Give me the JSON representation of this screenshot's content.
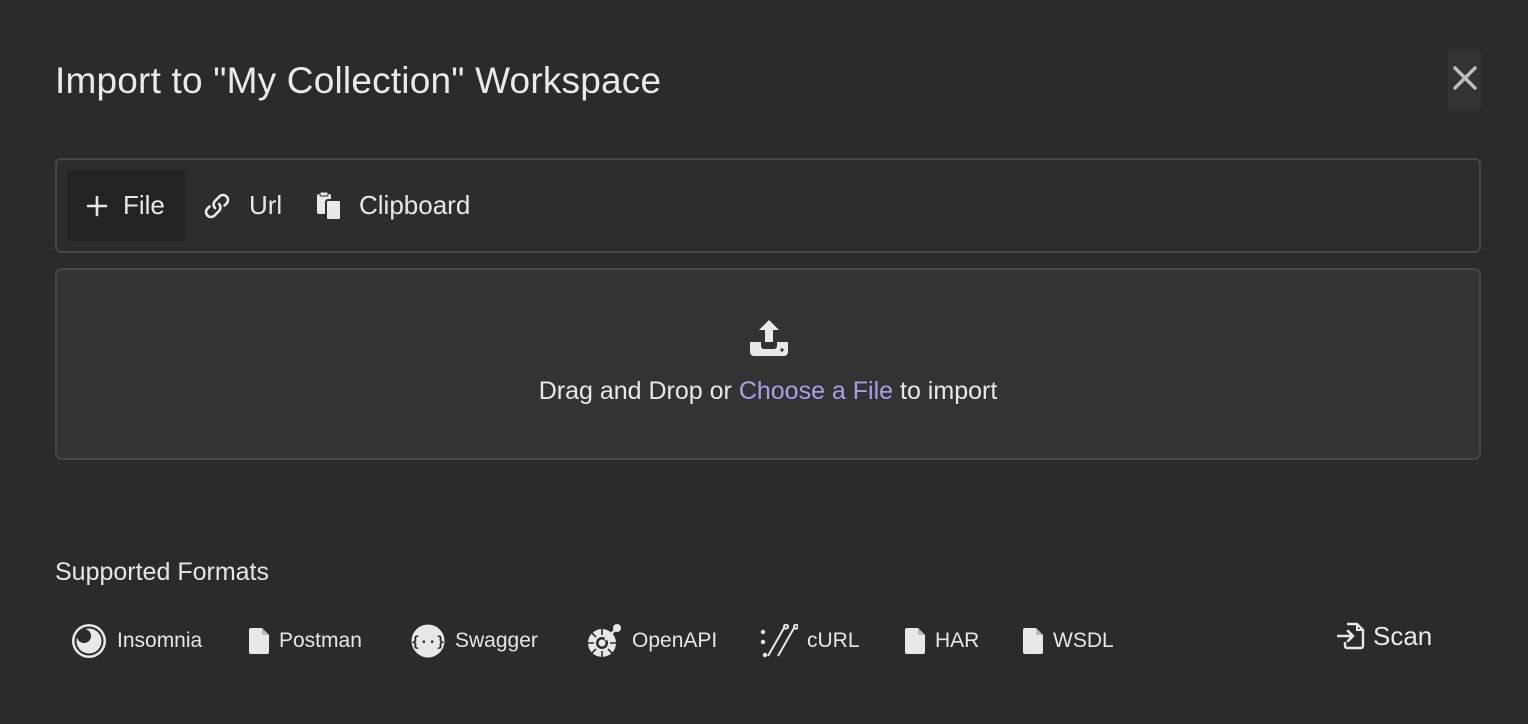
{
  "dialog": {
    "title": "Import to \"My Collection\" Workspace",
    "close_icon": "close-icon"
  },
  "tabs": [
    {
      "label": "File",
      "icon": "plus-icon",
      "active": true
    },
    {
      "label": "Url",
      "icon": "link-icon",
      "active": false
    },
    {
      "label": "Clipboard",
      "icon": "clipboard-icon",
      "active": false
    }
  ],
  "dropzone": {
    "icon": "upload-icon",
    "text_before": "Drag and Drop or",
    "link_text": "Choose a File",
    "text_after": "to import"
  },
  "supported": {
    "heading": "Supported Formats",
    "formats": [
      {
        "label": "Insomnia",
        "icon": "insomnia-icon"
      },
      {
        "label": "Postman",
        "icon": "file-icon"
      },
      {
        "label": "Swagger",
        "icon": "swagger-icon"
      },
      {
        "label": "OpenAPI",
        "icon": "openapi-icon"
      },
      {
        "label": "cURL",
        "icon": "curl-icon"
      },
      {
        "label": "HAR",
        "icon": "file-icon"
      },
      {
        "label": "WSDL",
        "icon": "file-icon"
      }
    ]
  },
  "scan": {
    "label": "Scan",
    "icon": "scan-icon"
  },
  "colors": {
    "background": "#2b2b2b",
    "panel": "#333333",
    "border": "#474747",
    "link": "#a99ee8",
    "text": "#e6e6e6"
  }
}
